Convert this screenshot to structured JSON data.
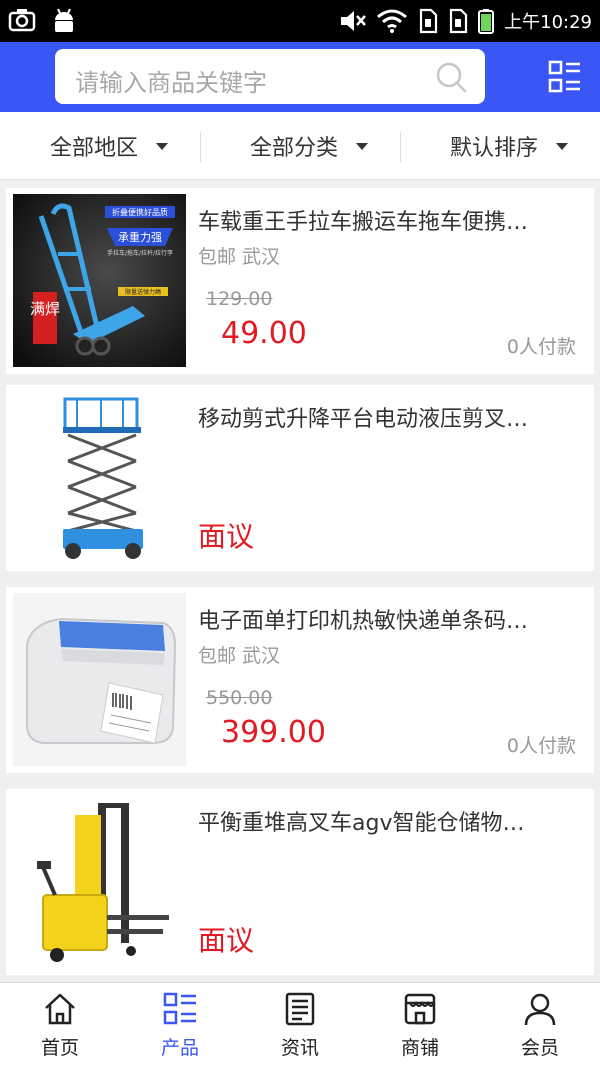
{
  "status_bar": {
    "time": "上午10:29"
  },
  "search": {
    "placeholder": "请输入商品关键字"
  },
  "filters": [
    {
      "label": "全部地区"
    },
    {
      "label": "全部分类"
    },
    {
      "label": "默认排序"
    }
  ],
  "products": [
    {
      "title": "车载重王手拉车搬运车拖车便携…",
      "tag": "包邮 武汉",
      "original_price": "129.00",
      "price": "49.00",
      "sales": "0人付款",
      "image": "hand-truck",
      "image_text": [
        "折叠便携好品质",
        "承重力强",
        "手拉车/拖车/拉杆/拉行李",
        "限量送弹力绳",
        "满焊"
      ]
    },
    {
      "title": "移动剪式升降平台电动液压剪叉…",
      "negotiable": "面议",
      "image": "scissor-lift"
    },
    {
      "title": "电子面单打印机热敏快递单条码…",
      "tag": "包邮 武汉",
      "original_price": "550.00",
      "price": "399.00",
      "sales": "0人付款",
      "image": "label-printer"
    },
    {
      "title": "平衡重堆高叉车agv智能仓储物…",
      "negotiable": "面议",
      "image": "stacker-forklift"
    }
  ],
  "bottom_nav": [
    {
      "label": "首页",
      "icon": "home-icon"
    },
    {
      "label": "产品",
      "icon": "product-list-icon",
      "active": true
    },
    {
      "label": "资讯",
      "icon": "news-icon"
    },
    {
      "label": "商铺",
      "icon": "shop-icon"
    },
    {
      "label": "会员",
      "icon": "member-icon"
    }
  ],
  "colors": {
    "primary": "#3a57f5",
    "price": "#e21b23",
    "status_bar": "#000000"
  }
}
